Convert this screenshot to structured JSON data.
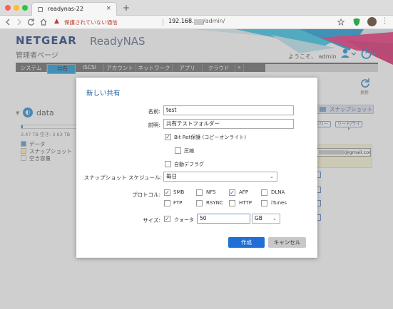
{
  "browser": {
    "tab_title": "readynas-22",
    "close_glyph": "×",
    "new_tab_glyph": "+",
    "insecure_label": "保護されていない通信",
    "host": "192.168.",
    "path": "/admin/",
    "window_controls": [
      "#ff5f57",
      "#febc2e",
      "#28c840"
    ],
    "icons": [
      "back-icon",
      "forward-icon",
      "reload-icon",
      "home-icon",
      "warning-icon",
      "star-icon",
      "shield-icon",
      "profile-icon",
      "menu-icon"
    ]
  },
  "app": {
    "brand": "NETGEAR",
    "product": "ReadyNAS",
    "subtitle": "管理者ページ",
    "welcome": "ようこそ、 admin",
    "accent": "#1f9ad6",
    "nav": [
      "システム",
      "共有",
      "iSCSI",
      "アカウント",
      "ネットワーク",
      "アプリ",
      "クラウド",
      "»"
    ],
    "selected_nav": "共有",
    "refresh_label": "更新"
  },
  "volume": {
    "name": "data",
    "used_fraction": 0.01,
    "capacity": "3.47 TB 空き: 3.63 TB",
    "legend": [
      {
        "label": "データ",
        "color": "#5b9bd5"
      },
      {
        "label": "スナップショット",
        "color": "#fff2a8"
      },
      {
        "label": "空き容量",
        "color": "#ffffff"
      }
    ]
  },
  "background": {
    "snapshot_button": "スナップショット",
    "readonly_label": "ンリー",
    "readwrite_label": "リード/ライト",
    "email_value": "@gmail.com"
  },
  "dialog": {
    "title": "新しい共有",
    "name_label": "名前:",
    "name_value": "test",
    "desc_label": "説明:",
    "desc_value": "共有テストフォルダー",
    "bitrot_label": "Bit Rot保護 (コピーオンライト)",
    "bitrot_checked": true,
    "compress_label": "圧縮",
    "compress_checked": false,
    "defrag_label": "自動デフラグ",
    "defrag_checked": false,
    "schedule_label": "スナップショット スケジュール:",
    "schedule_value": "毎日",
    "protocol_label": "プロトコル:",
    "protocols": [
      {
        "label": "SMB",
        "checked": true
      },
      {
        "label": "NFS",
        "checked": false
      },
      {
        "label": "AFP",
        "checked": true
      },
      {
        "label": "DLNA",
        "checked": false
      },
      {
        "label": "FTP",
        "checked": false
      },
      {
        "label": "RSYNC",
        "checked": false
      },
      {
        "label": "HTTP",
        "checked": false
      },
      {
        "label": "iTunes",
        "checked": false
      }
    ],
    "size_label": "サイズ:",
    "quota_label": "クォータ",
    "quota_checked": true,
    "quota_value": "50",
    "unit_value": "GB",
    "create_label": "作成",
    "cancel_label": "キャンセル",
    "check_glyph": "✓",
    "chevron_glyph": "⌄"
  }
}
